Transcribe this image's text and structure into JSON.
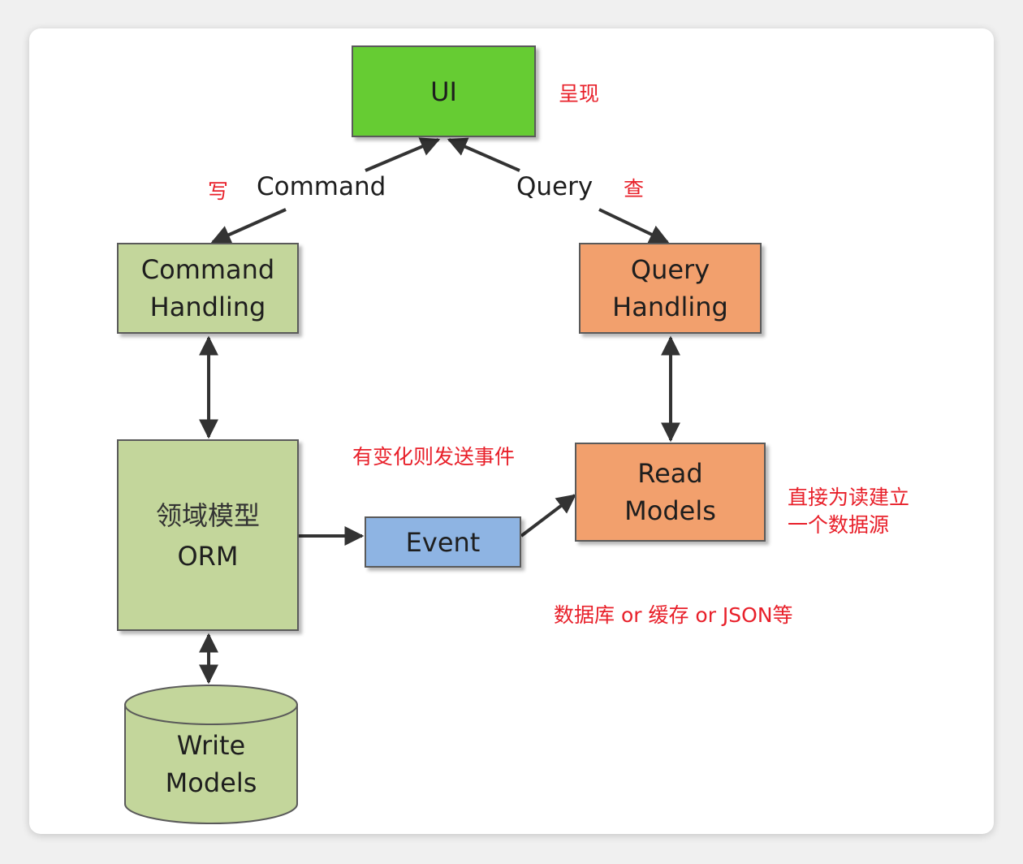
{
  "nodes": {
    "ui": "UI",
    "command_handling": [
      "Command",
      "Handling"
    ],
    "query_handling": [
      "Query",
      "Handling"
    ],
    "domain_model": [
      "领域模型",
      "ORM"
    ],
    "event": "Event",
    "read_models": [
      "Read",
      "Models"
    ],
    "write_models": [
      "Write",
      "Models"
    ]
  },
  "labels": {
    "command": "Command",
    "query": "Query"
  },
  "annotations": {
    "present": "呈现",
    "write": "写",
    "query": "查",
    "send_event": "有变化则发送事件",
    "direct_source_line1": "直接为读建立",
    "direct_source_line2": "一个数据源",
    "storage": "数据库 or 缓存 or JSON等"
  }
}
